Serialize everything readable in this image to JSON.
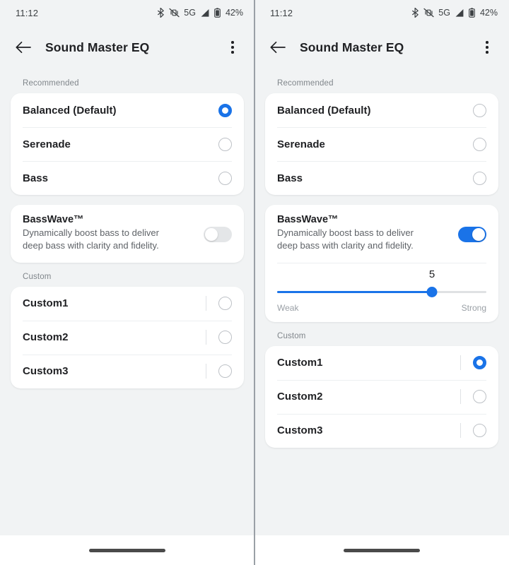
{
  "statusbar": {
    "time": "11:12",
    "battery_percent": "42%",
    "network": "5G",
    "icons": [
      "bluetooth-icon",
      "vibrate-muted-icon",
      "network-5g-label",
      "signal-bars-icon",
      "battery-icon"
    ]
  },
  "toolbar": {
    "back_label": "back-arrow",
    "title": "Sound Master EQ",
    "overflow_label": "more-options"
  },
  "sections": {
    "recommended_label": "Recommended",
    "custom_label": "Custom"
  },
  "presets": {
    "recommended": [
      {
        "label": "Balanced (Default)"
      },
      {
        "label": "Serenade"
      },
      {
        "label": "Bass"
      }
    ],
    "custom": [
      {
        "label": "Custom1"
      },
      {
        "label": "Custom2"
      },
      {
        "label": "Custom3"
      }
    ]
  },
  "basswave": {
    "title": "BassWave™",
    "description": "Dynamically boost bass to deliver deep bass with clarity and fidelity.",
    "slider_value": "5",
    "slider_percent": 74,
    "min_label": "Weak",
    "max_label": "Strong"
  },
  "panels": {
    "left": {
      "recommended_selected": 0,
      "custom_selected": -1,
      "basswave_on": false,
      "slider_visible": false
    },
    "right": {
      "recommended_selected": -1,
      "custom_selected": 0,
      "basswave_on": true,
      "slider_visible": true
    }
  },
  "colors": {
    "accent": "#1a73e8",
    "background": "#f1f3f4",
    "card": "#ffffff",
    "text_primary": "#202124",
    "text_secondary": "#5f6368",
    "text_muted": "#80868b"
  }
}
